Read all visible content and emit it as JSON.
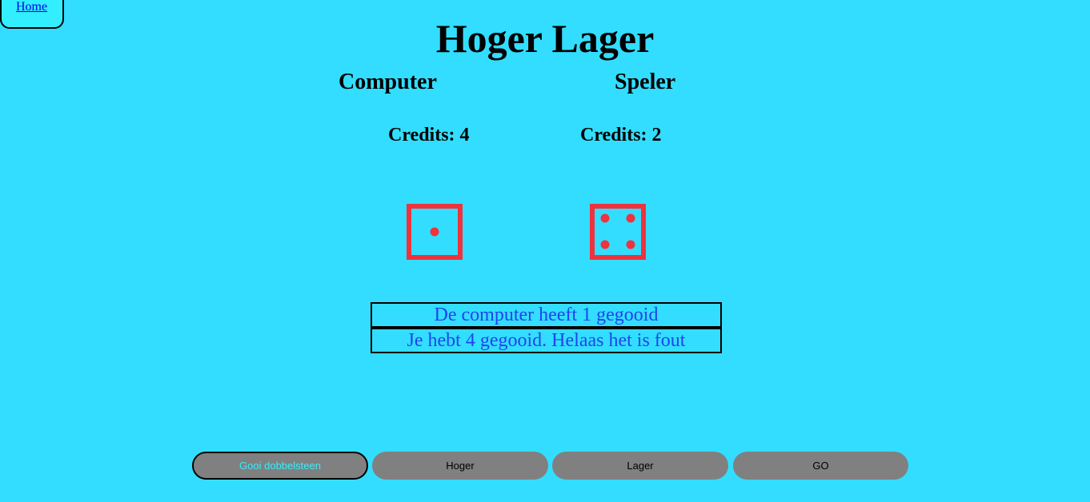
{
  "nav": {
    "home_label": "Home"
  },
  "header": {
    "title": "Hoger Lager"
  },
  "players": {
    "computer": {
      "label": "Computer",
      "credits_text": "Credits: 4",
      "die_value": 1
    },
    "player": {
      "label": "Speler",
      "credits_text": "Credits: 2",
      "die_value": 4
    }
  },
  "messages": {
    "computer_roll": "De computer heeft 1 gegooid",
    "player_roll": "Je hebt 4 gegooid. Helaas het is fout"
  },
  "buttons": {
    "roll_label": "Gooi dobbelsteen",
    "higher_label": "Hoger",
    "lower_label": "Lager",
    "go_label": "GO"
  },
  "colors": {
    "background": "#33ddff",
    "die": "#f0323c",
    "message_text": "#1f44ee",
    "button": "#808080"
  }
}
